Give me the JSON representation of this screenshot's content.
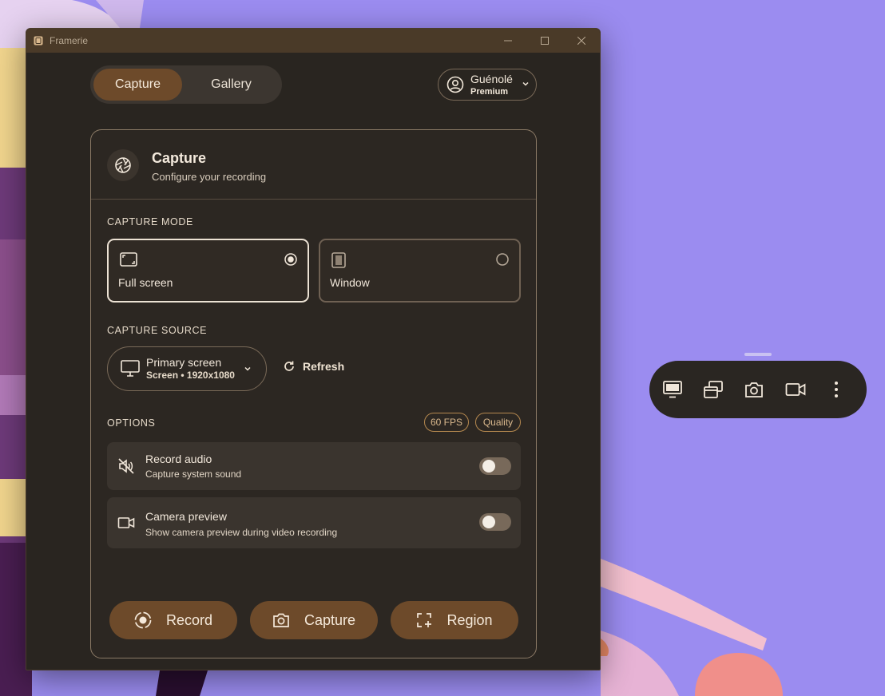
{
  "window": {
    "title": "Framerie"
  },
  "nav": {
    "tabs": [
      {
        "label": "Capture",
        "active": true
      },
      {
        "label": "Gallery",
        "active": false
      }
    ]
  },
  "account": {
    "name": "Guénolé",
    "plan": "Premium"
  },
  "card": {
    "title": "Capture",
    "subtitle": "Configure your recording"
  },
  "capture_mode": {
    "label": "CAPTURE MODE",
    "options": [
      {
        "label": "Full screen",
        "icon": "fullscreen-icon",
        "selected": true
      },
      {
        "label": "Window",
        "icon": "window-icon",
        "selected": false
      }
    ]
  },
  "capture_source": {
    "label": "CAPTURE SOURCE",
    "selected_name": "Primary screen",
    "selected_detail": "Screen • 1920x1080",
    "refresh_label": "Refresh"
  },
  "options": {
    "label": "OPTIONS",
    "badges": [
      "60 FPS",
      "Quality"
    ],
    "items": [
      {
        "title": "Record audio",
        "subtitle": "Capture system sound",
        "icon": "audio-muted-icon",
        "enabled": false
      },
      {
        "title": "Camera preview",
        "subtitle": "Show camera preview during video recording",
        "icon": "camera-video-icon",
        "enabled": false
      }
    ]
  },
  "actions": [
    {
      "label": "Record",
      "icon": "record-icon"
    },
    {
      "label": "Capture",
      "icon": "camera-icon"
    },
    {
      "label": "Region",
      "icon": "region-select-icon"
    }
  ],
  "floating_toolbar": {
    "buttons": [
      "screen-icon",
      "windows-icon",
      "camera-icon",
      "video-icon",
      "more-icon"
    ]
  },
  "colors": {
    "accent": "#6d4a2a",
    "window_bg": "#292520",
    "titlebar": "#4a3a28",
    "chip_border": "#b6894f",
    "desktop_bg": "#9b8cf0"
  }
}
